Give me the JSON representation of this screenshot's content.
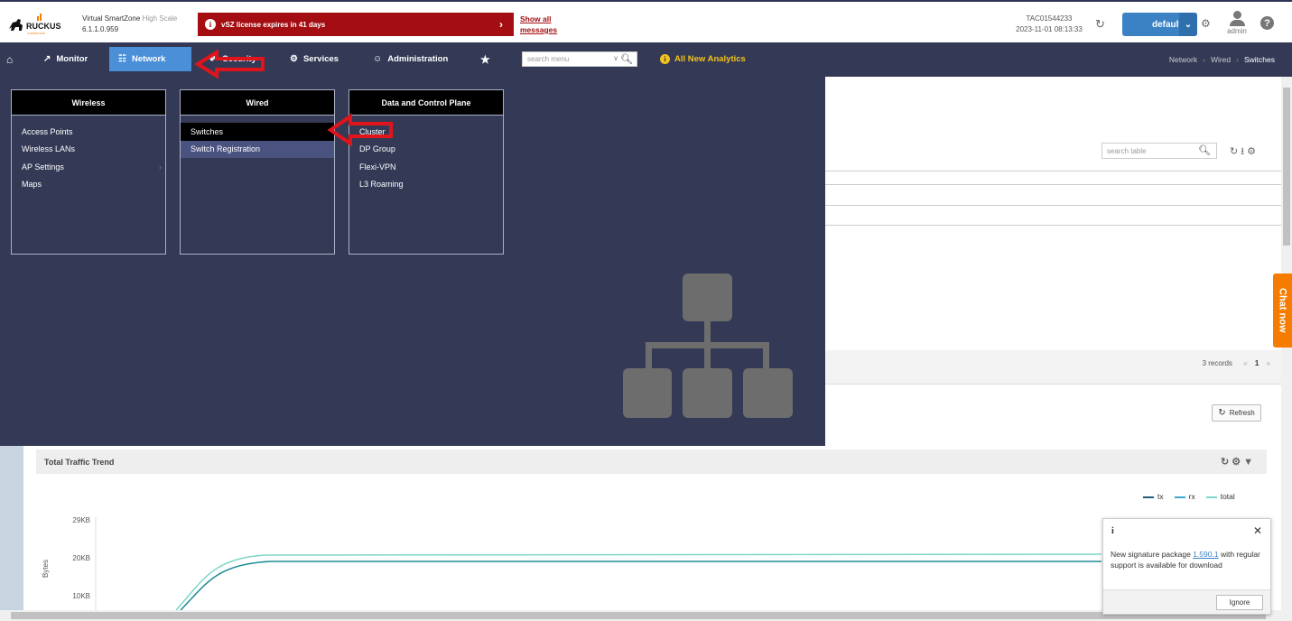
{
  "header": {
    "product_name": "Virtual SmartZone",
    "product_edition": "High Scale",
    "version": "6.1.1.0.959",
    "license_message": "vSZ license expires in 41 days",
    "show_all_line1": "Show all",
    "show_all_line2": "messages",
    "session_id": "TAC01544233",
    "session_time": "2023-11-01  08:13:33",
    "domain": "default",
    "user": "admin"
  },
  "nav": {
    "items": [
      {
        "label": "Monitor"
      },
      {
        "label": "Network"
      },
      {
        "label": "Security"
      },
      {
        "label": "Services"
      },
      {
        "label": "Administration"
      }
    ],
    "search_placeholder": "search menu",
    "analytics": "All New Analytics",
    "breadcrumb": [
      "Network",
      "Wired",
      "Switches"
    ]
  },
  "megamenu": {
    "columns": [
      {
        "title": "Wireless",
        "items": [
          "Access Points",
          "Wireless LANs",
          "AP Settings",
          "Maps"
        ]
      },
      {
        "title": "Wired",
        "items": [
          "Switches",
          "Switch Registration"
        ]
      },
      {
        "title": "Data and Control Plane",
        "items": [
          "Cluster",
          "DP Group",
          "Flexi-VPN",
          "L3 Roaming"
        ]
      }
    ]
  },
  "table": {
    "search_placeholder": "search table",
    "records": "3 records",
    "page": "1",
    "refresh_label": "Refresh"
  },
  "traffic": {
    "title": "Total Traffic Trend",
    "ylabel": "Bytes",
    "yticks": [
      "29KB",
      "20KB",
      "10KB"
    ],
    "legend": [
      {
        "name": "tx",
        "color": "#1f5f7a"
      },
      {
        "name": "rx",
        "color": "#3aa8c8"
      },
      {
        "name": "total",
        "color": "#7fd6c8"
      }
    ]
  },
  "chat": {
    "label": "Chat now"
  },
  "notification": {
    "icon": "i",
    "text_before": "New signature package ",
    "link": "1.590.1",
    "text_after": " with regular support is available for download",
    "button": "Ignore"
  },
  "colors": {
    "nav_bg": "#343a56",
    "active_tab": "#4a8fd8",
    "license_bg": "#a40e12",
    "analytics": "#f2c21a",
    "chat": "#f57c00"
  }
}
